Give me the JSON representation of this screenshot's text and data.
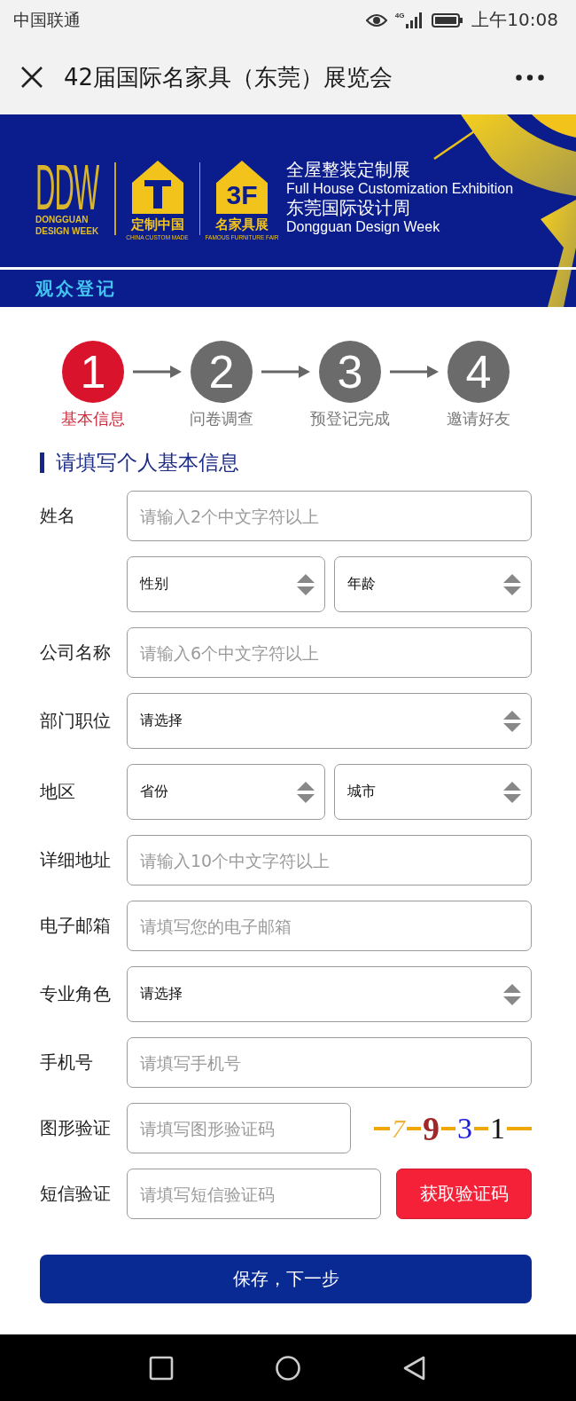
{
  "status_bar": {
    "carrier": "中国联通",
    "network": "4G",
    "time": "上午10:08"
  },
  "title_bar": {
    "title": "42届国际名家具（东莞）展览会"
  },
  "banner": {
    "logos": [
      {
        "kind": "ddw",
        "mark": "DDW",
        "caption": "DONGGUAN DESIGN WEEK"
      },
      {
        "kind": "house_icon",
        "name": "定制中国",
        "caption": "CHINA CUSTOM MADE"
      },
      {
        "kind": "house_text",
        "mark": "3F",
        "name": "名家具展",
        "caption": "FAMOUS FURNITURE FAIR"
      }
    ],
    "headlines": [
      {
        "kind": "cn",
        "text": "全屋整装定制展"
      },
      {
        "kind": "en",
        "text": "Full House Customization Exhibition"
      },
      {
        "kind": "cn",
        "text": "东莞国际设计周"
      },
      {
        "kind": "en",
        "text": "Dongguan Design Week"
      }
    ],
    "subtitle": "观众登记"
  },
  "steps": [
    {
      "number": "1",
      "label": "基本信息",
      "selected": true
    },
    {
      "number": "2",
      "label": "问卷调查",
      "selected": false
    },
    {
      "number": "3",
      "label": "预登记完成",
      "selected": false
    },
    {
      "number": "4",
      "label": "邀请好友",
      "selected": false
    }
  ],
  "form": {
    "heading": "请填写个人基本信息",
    "rows": [
      {
        "kind": "input",
        "label": "姓名",
        "placeholder": "请输入2个中文字符以上"
      },
      {
        "kind": "select_pair",
        "selects": [
          {
            "value": "性别"
          },
          {
            "value": "年龄"
          }
        ]
      },
      {
        "kind": "input",
        "label": "公司名称",
        "placeholder": "请输入6个中文字符以上"
      },
      {
        "kind": "select",
        "label": "部门职位",
        "value": "请选择"
      },
      {
        "kind": "select_pair",
        "label": "地区",
        "selects": [
          {
            "value": "省份"
          },
          {
            "value": "城市"
          }
        ]
      },
      {
        "kind": "input",
        "label": "详细地址",
        "placeholder": "请输入10个中文字符以上"
      },
      {
        "kind": "input",
        "label": "电子邮箱",
        "placeholder": "请填写您的电子邮箱"
      },
      {
        "kind": "select",
        "label": "专业角色",
        "value": "请选择"
      },
      {
        "kind": "input",
        "label": "手机号",
        "placeholder": "请填写手机号"
      },
      {
        "kind": "captcha",
        "label": "图形验证",
        "placeholder": "请填写图形验证码",
        "captcha": [
          {
            "text": "7",
            "color": "#f0b43c"
          },
          {
            "text": "9",
            "color": "#a02828"
          },
          {
            "text": "3",
            "color": "#1a1ad8"
          },
          {
            "text": "1",
            "color": "#111111"
          }
        ]
      },
      {
        "kind": "sms",
        "label": "短信验证",
        "placeholder": "请填写短信验证码",
        "button": "获取验证码"
      }
    ]
  },
  "submit_button": "保存，下一步"
}
